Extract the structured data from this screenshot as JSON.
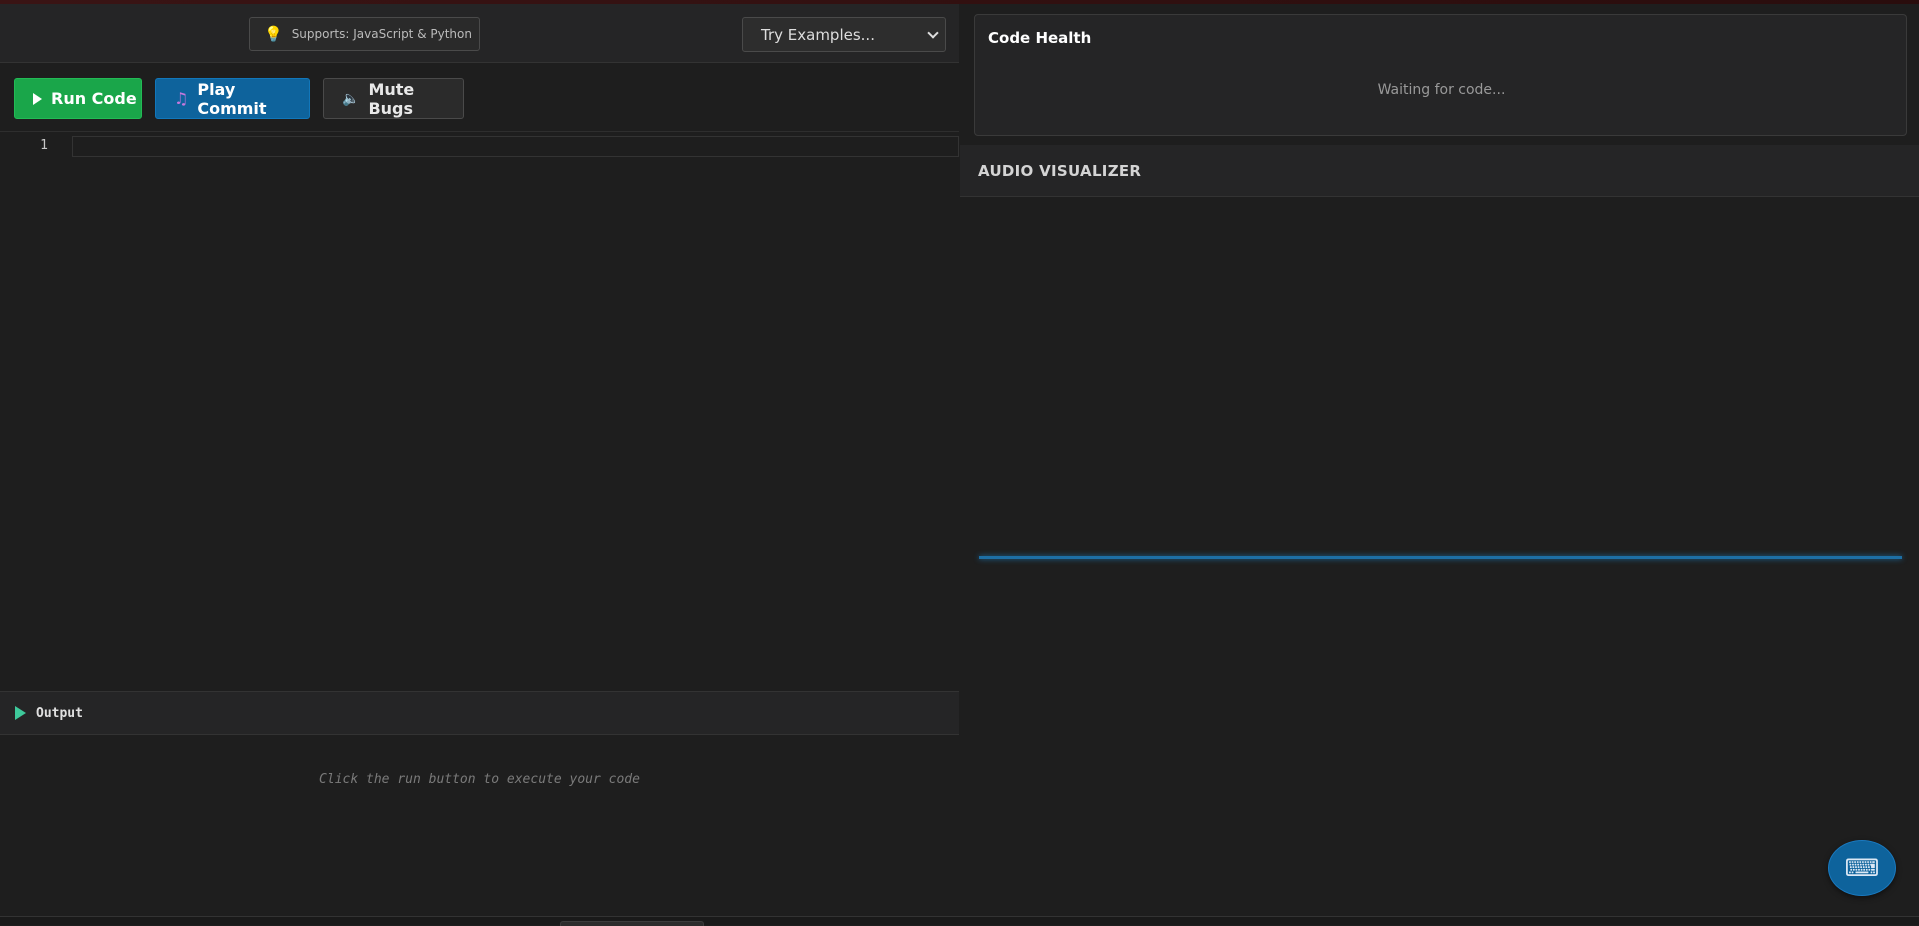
{
  "topbar": {
    "supports_label": "Supports: JavaScript & Python",
    "examples_select": {
      "selected": "Try Examples..."
    }
  },
  "toolbar": {
    "run_label": "Run Code",
    "play_label": "Play Commit",
    "mute_label": "Mute Bugs"
  },
  "editor": {
    "line_numbers": [
      "1"
    ]
  },
  "output": {
    "title": "Output",
    "placeholder": "Click the run button to execute your code"
  },
  "code_health": {
    "title": "Code Health",
    "status": "Waiting for code..."
  },
  "visualizer": {
    "title": "AUDIO VISUALIZER"
  },
  "icons": {
    "supports": "lightbulb-icon",
    "run": "play-triangle-icon",
    "play_commit": "music-note-icon",
    "mute": "speaker-icon",
    "output": "play-triangle-icon",
    "fab": "keyboard-icon"
  },
  "colors": {
    "run_button": "#1aa64a",
    "play_button": "#0e639c",
    "visualizer_line": "#1d6fa5",
    "output_icon": "#3ec99b"
  }
}
